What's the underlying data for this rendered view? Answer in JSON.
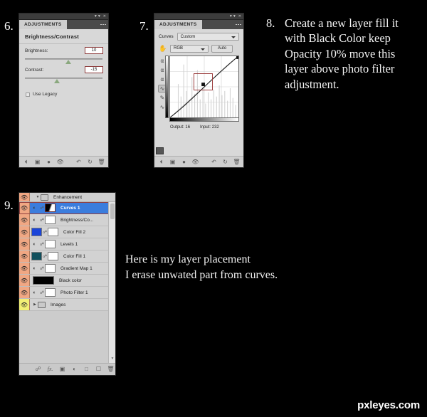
{
  "steps": {
    "six": "6.",
    "seven": "7.",
    "eight": "8.",
    "nine": "9."
  },
  "panel_brightness": {
    "tab": "ADJUSTMENTS",
    "title": "Brightness/Contrast",
    "brightness_label": "Brightness:",
    "brightness_value": "10",
    "contrast_label": "Contrast:",
    "contrast_value": "-15",
    "use_legacy_label": "Use Legacy",
    "footer_icons": [
      "clip-to-layer-icon",
      "view-previous-state-icon",
      "preview-toggle-icon",
      "eye-icon",
      "reset-icon",
      "return-icon",
      "delete-icon"
    ]
  },
  "panel_curves": {
    "tab": "ADJUSTMENTS",
    "preset_label": "Curves",
    "preset_value": "Custom",
    "channel_value": "RGB",
    "auto_label": "Auto",
    "output_label": "Output:",
    "output_value": "16",
    "input_label": "Input:",
    "input_value": "232",
    "tools": [
      "on-image-adjust-icon",
      "black-point-eyedropper-icon",
      "gray-point-eyedropper-icon",
      "white-point-eyedropper-icon",
      "curve-point-tool-icon",
      "pencil-tool-icon",
      "smooth-curve-icon"
    ],
    "footer_icons": [
      "clip-to-layer-icon",
      "view-previous-state-icon",
      "preview-toggle-icon",
      "eye-icon",
      "reset-icon",
      "return-icon",
      "delete-icon"
    ]
  },
  "panel_layers": {
    "group_name": "Enhancement",
    "layers": [
      {
        "name": "Curves 1",
        "thumb": "mask-curves",
        "selected": true,
        "has_disc": true,
        "eye": "orange"
      },
      {
        "name": "Brightness/Co...",
        "thumb": "white",
        "selected": false,
        "has_disc": true,
        "eye": "orange"
      },
      {
        "name": "Color Fill 2",
        "thumb": "white",
        "selected": false,
        "has_disc": false,
        "swatch": "blue",
        "eye": "orange"
      },
      {
        "name": "Levels 1",
        "thumb": "white",
        "selected": false,
        "has_disc": true,
        "eye": "orange"
      },
      {
        "name": "Color Fill 1",
        "thumb": "white",
        "selected": false,
        "has_disc": false,
        "swatch": "teal",
        "eye": "orange"
      },
      {
        "name": "Gradient Map 1",
        "thumb": "white",
        "selected": false,
        "has_disc": true,
        "eye": "orange"
      },
      {
        "name": "Black color",
        "thumb": "black",
        "selected": false,
        "has_disc": false,
        "eye": "orange"
      },
      {
        "name": "Photo Filter 1",
        "thumb": "white",
        "selected": false,
        "has_disc": true,
        "eye": "orange"
      }
    ],
    "bottom_group": "Images",
    "footer_icons": [
      "link-layers-icon",
      "layer-style-fx-icon",
      "add-mask-icon",
      "adjustment-layer-icon",
      "new-group-icon",
      "new-layer-icon",
      "delete-layer-icon"
    ]
  },
  "instruction_8": {
    "number": "8.",
    "text": "Create a new layer fill it with Black Color keep Opacity 10% move this layer above photo filter adjustment."
  },
  "instruction_9": {
    "line1": "Here is my layer placement",
    "line2": "I erase unwated part from curves."
  },
  "watermark": "pxleyes.com",
  "colors": {
    "background": "#000000",
    "panel_gray": "#d8d8d8",
    "selection_blue": "#3b7ddd",
    "eye_column": "#f0a783",
    "eye_column_active": "#f2f075",
    "red_highlight": "#9b3c3c",
    "slider_thumb": "#8aa87e"
  }
}
